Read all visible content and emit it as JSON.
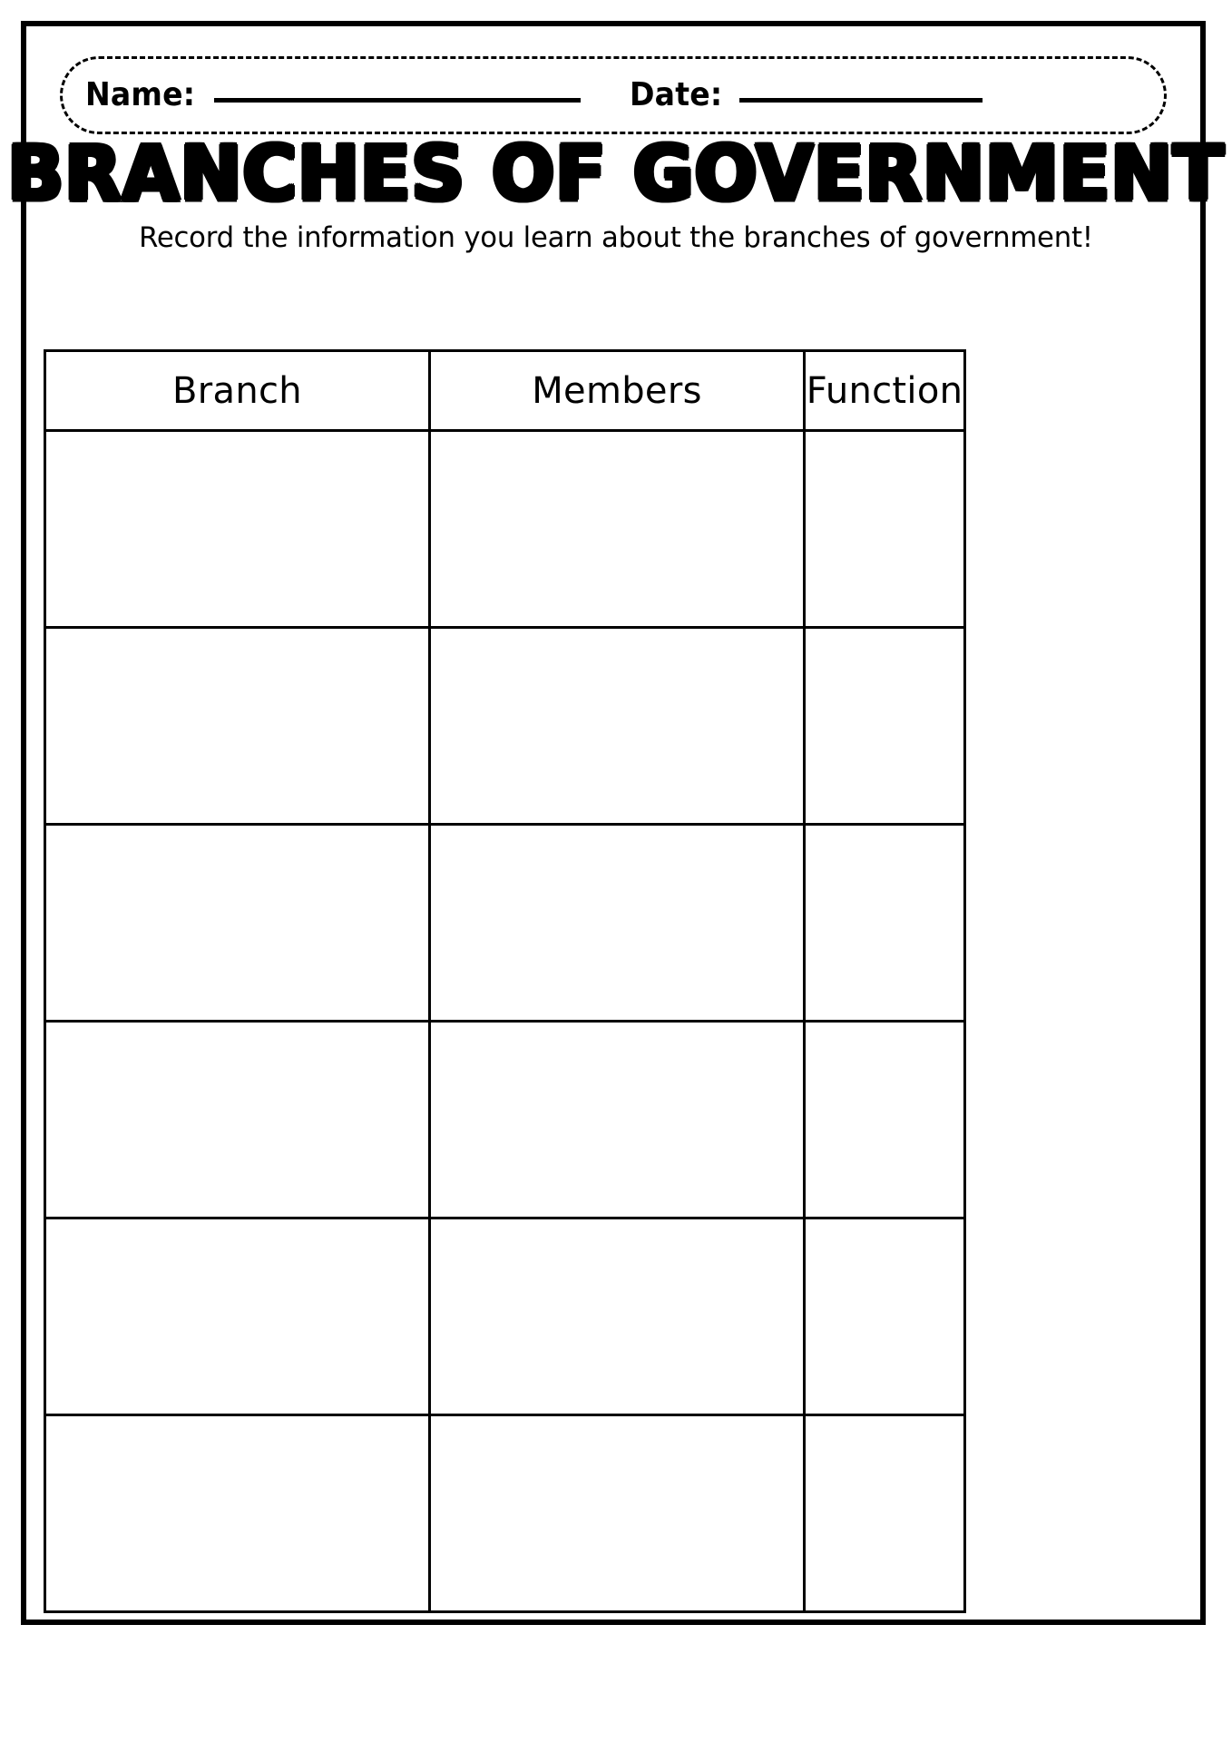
{
  "document": {
    "type": "printable-worksheet",
    "title": "BRANCHES OF GOVERNMENT",
    "subtitle": "Record the information you learn about the branches of government!"
  },
  "header": {
    "name_label": "Name:",
    "date_label": "Date:",
    "name_value": "",
    "date_value": ""
  },
  "table": {
    "columns": [
      "Branch",
      "Members",
      "Function"
    ],
    "rows": [
      [
        "",
        "",
        ""
      ],
      [
        "",
        "",
        ""
      ],
      [
        "",
        "",
        ""
      ],
      [
        "",
        "",
        ""
      ],
      [
        "",
        "",
        ""
      ],
      [
        "",
        "",
        ""
      ]
    ]
  },
  "colors": {
    "ink": "#000000",
    "paper": "#ffffff"
  }
}
